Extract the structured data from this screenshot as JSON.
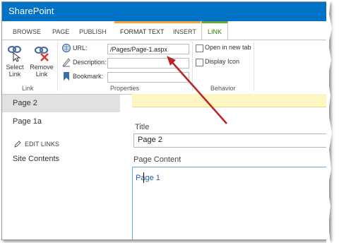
{
  "app": {
    "brand": "SharePoint"
  },
  "ribbon_tabs": [
    "BROWSE",
    "PAGE",
    "PUBLISH",
    "FORMAT TEXT",
    "INSERT",
    "LINK"
  ],
  "link_group": {
    "select_link_1": "Select",
    "select_link_2": "Link",
    "remove_link_1": "Remove",
    "remove_link_2": "Link",
    "label": "Link"
  },
  "properties_group": {
    "url_label": "URL:",
    "url_value": "/Pages/Page-1.aspx",
    "description_label": "Description:",
    "description_value": "",
    "bookmark_label": "Bookmark:",
    "bookmark_value": "",
    "label": "Properties"
  },
  "behavior_group": {
    "open_new_tab": "Open in new tab",
    "display_icon": "Display Icon",
    "label": "Behavior"
  },
  "nav": {
    "selected": "Page 2",
    "item2": "Page 1a",
    "edit_links": "EDIT LINKS",
    "site_contents": "Site Contents"
  },
  "form": {
    "title_label": "Title",
    "title_value": "Page 2",
    "content_label": "Page Content",
    "content_value": "Page 1"
  },
  "colors": {
    "suite_bar": "#0072c6",
    "format_accent": "#f7a33a",
    "link_accent": "#68a83b",
    "arrow": "#b8282b"
  }
}
